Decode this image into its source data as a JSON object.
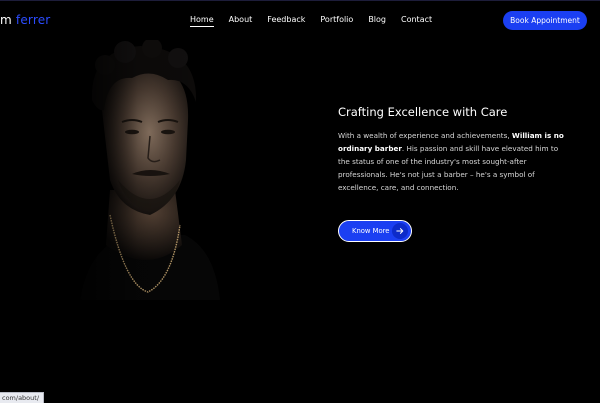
{
  "brand": {
    "first": "m",
    "last": "ferrer"
  },
  "nav": [
    {
      "label": "Home",
      "active": true
    },
    {
      "label": "About"
    },
    {
      "label": "Feedback"
    },
    {
      "label": "Portfolio"
    },
    {
      "label": "Blog"
    },
    {
      "label": "Contact"
    }
  ],
  "header": {
    "cta_label": "Book Appointment"
  },
  "hero": {
    "title": "Crafting Excellence with Care",
    "desc_intro": "With a wealth of experience and achievements, ",
    "desc_bold": "William is no ordinary barber",
    "desc_rest": ". His passion and skill have elevated him to the status of one of the industry's most sought-after professionals. He's not just a barber – he's a symbol of excellence, care, and connection.",
    "button_label": "Know More"
  },
  "status_bar": {
    "url": "com/about/"
  },
  "colors": {
    "accent": "#1b3ff2",
    "background": "#000000"
  },
  "icons": {
    "button_arrow": "arrow-right-icon"
  }
}
